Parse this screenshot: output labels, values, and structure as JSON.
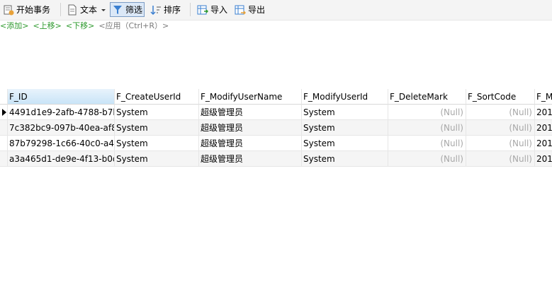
{
  "toolbar": {
    "begin_transaction": "开始事务",
    "text": "文本",
    "filter": "筛选",
    "sort": "排序",
    "import": "导入",
    "export": "导出"
  },
  "filter_bar": {
    "add": "<添加>",
    "move_up": "<上移>",
    "move_down": "<下移>",
    "apply": "<应用（Ctrl+R）>"
  },
  "table": {
    "columns": [
      "F_ID",
      "F_CreateUserId",
      "F_ModifyUserName",
      "F_ModifyUserId",
      "F_DeleteMark",
      "F_SortCode",
      "F_M"
    ],
    "rows": [
      [
        "4491d1e9-2afb-4788-b7b",
        "System",
        "超级管理员",
        "System",
        "(Null)",
        "(Null)",
        "201"
      ],
      [
        "7c382bc9-097b-40ea-af8",
        "System",
        "超级管理员",
        "System",
        "(Null)",
        "(Null)",
        "201"
      ],
      [
        "87b79298-1c66-40c0-a44",
        "System",
        "超级管理员",
        "System",
        "(Null)",
        "(Null)",
        "201"
      ],
      [
        "a3a465d1-de9e-4f13-b0d",
        "System",
        "超级管理员",
        "System",
        "(Null)",
        "(Null)",
        "201"
      ]
    ]
  },
  "colors": {
    "link_green": "#2e9a2e",
    "null_gray": "#a8a8a8",
    "selected_header": "#c9e4f7"
  }
}
